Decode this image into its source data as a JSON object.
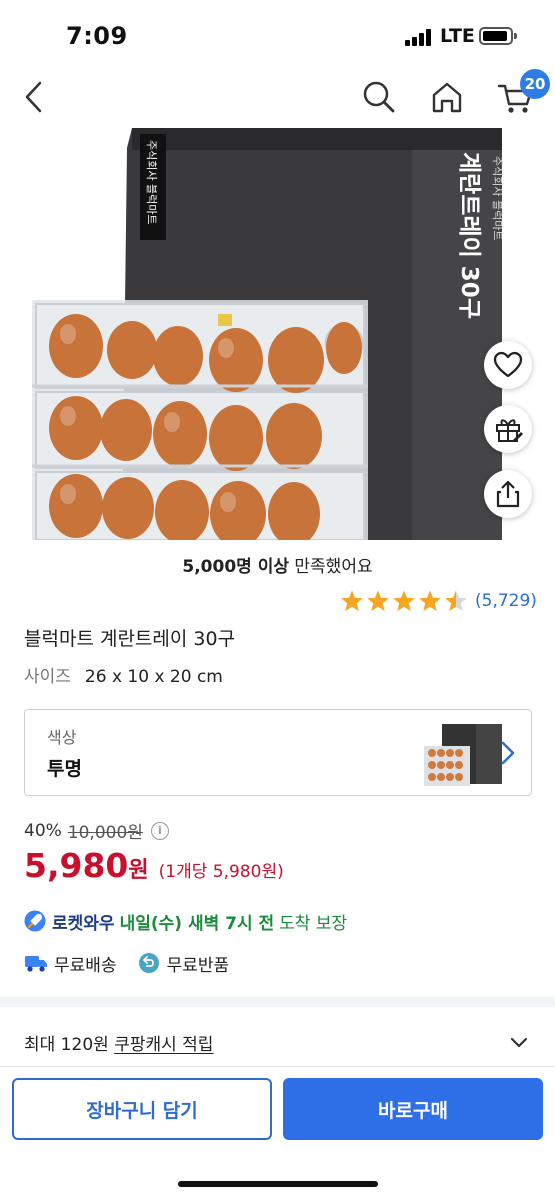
{
  "status": {
    "time": "7:09",
    "network": "LTE"
  },
  "nav": {
    "back_icon": "chevron-left-icon",
    "search_icon": "search-icon",
    "home_icon": "home-icon",
    "cart_icon": "cart-icon",
    "cart_count": "20"
  },
  "hero": {
    "box_side_text": "주식회사 블럭마트",
    "box_front_text": "계란트레이 30구",
    "box_front_small": "주식회사 블럭마트"
  },
  "side_actions": [
    "heart-icon",
    "gift-icon",
    "share-icon"
  ],
  "satisfaction": {
    "bold": "5,000명 이상",
    "rest": " 만족했어요"
  },
  "rating": {
    "stars": 4.5,
    "count": "(5,729)",
    "color": "#f5a623"
  },
  "product": {
    "title": "블럭마트 계란트레이 30구",
    "size_label": "사이즈",
    "size_value": "26 x 10 x 20 cm"
  },
  "option": {
    "label": "색상",
    "value": "투명"
  },
  "pricing": {
    "discount": "40%",
    "original": "10,000원",
    "price": "5,980",
    "won": "원",
    "unit_price": "(1개당 5,980원)",
    "price_color": "#c8102e"
  },
  "delivery": {
    "brand": "로켓와우",
    "eta_bold": "내일(수) 새벽 7시 전",
    "eta_rest": "도착 보장",
    "free_shipping": "무료배송",
    "free_return": "무료반품"
  },
  "cash": {
    "prefix": "최대 120원 ",
    "link": "쿠팡캐시 적립"
  },
  "actions": {
    "add_to_cart": "장바구니 담기",
    "buy_now": "바로구매"
  },
  "colors": {
    "accent": "#2e6ee6",
    "rocket_green": "#1a8c3a"
  }
}
